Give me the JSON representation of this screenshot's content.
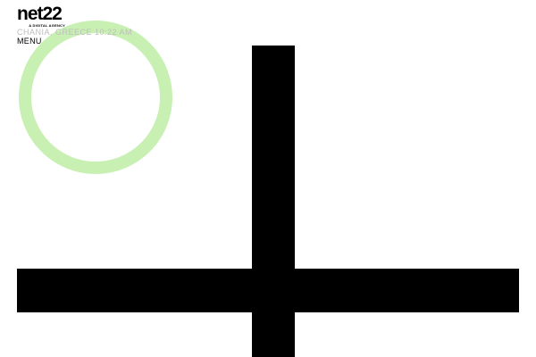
{
  "header": {
    "logo_text": "net22",
    "logo_tagline": "A DIGITAL AGENCY",
    "location": "CHANIA, GREECE",
    "time": "10:22 AM",
    "menu_label": "MENU"
  },
  "colors": {
    "accent_ring": "#c9f0b3",
    "shapes": "#000000",
    "muted_text": "#bdbdbd",
    "background": "#ffffff"
  }
}
